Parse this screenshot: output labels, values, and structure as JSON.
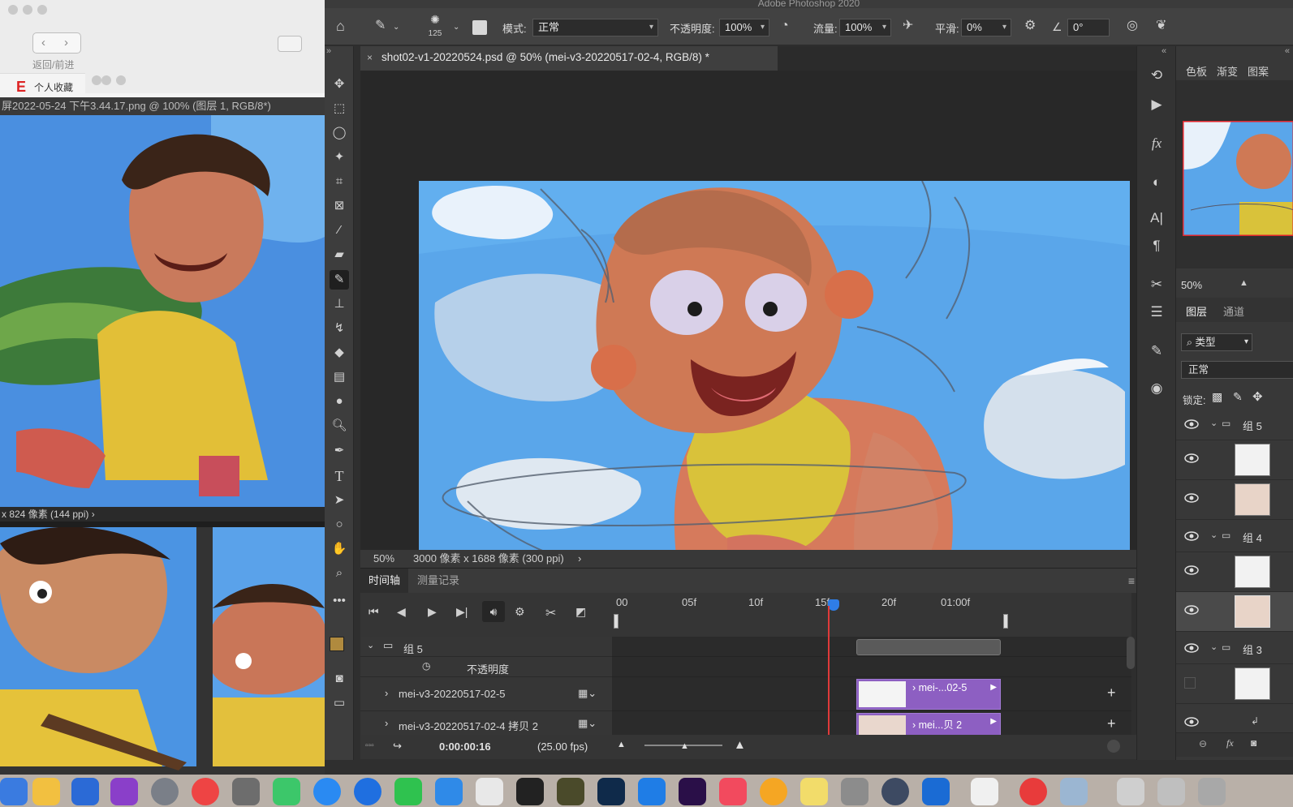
{
  "back_windows": {
    "safari": {
      "nav_label": "返回/前进",
      "favorites_label": "个人收藏"
    },
    "preview_title": "屏2022-05-24 下午3.44.17.png @ 100% (图层 1, RGB/8*)",
    "preview_status": "x 824 像素 (144 ppi)"
  },
  "app": {
    "title": "Adobe Photoshop 2020"
  },
  "options_bar": {
    "brush_size": "125",
    "mode_label": "模式:",
    "mode_value": "正常",
    "opacity_label": "不透明度:",
    "opacity_value": "100%",
    "flow_label": "流量:",
    "flow_value": "100%",
    "smoothing_label": "平滑:",
    "smoothing_value": "0%",
    "angle_value": "0°"
  },
  "document": {
    "tab_title": "shot02-v1-20220524.psd @ 50% (mei-v3-20220517-02-4, RGB/8) *",
    "zoom": "50%",
    "size_info": "3000 像素 x 1688 像素 (300 ppi)"
  },
  "timeline": {
    "tabs": [
      "时间轴",
      "测量记录"
    ],
    "ruler_labels": [
      "00",
      "05f",
      "10f",
      "15f",
      "20f",
      "01:00f"
    ],
    "playhead_frame": 16,
    "group_name": "组 5",
    "opacity_row": "不透明度",
    "layers": [
      {
        "name": "mei-v3-20220517-02-5",
        "clip_label": "mei-...02-5"
      },
      {
        "name": "mei-v3-20220517-02-4 拷贝 2",
        "clip_label": "mei...贝 2"
      }
    ],
    "timecode": "0:00:00:16",
    "fps": "(25.00 fps)"
  },
  "right_panel": {
    "top_tabs": [
      "色板",
      "渐变",
      "图案"
    ],
    "nav_zoom": "50%",
    "layer_tabs": [
      "图层",
      "通道"
    ],
    "filter_kind": "类型",
    "blend_mode": "正常",
    "lock_label": "锁定:",
    "groups": [
      "组 5",
      "组 4",
      "组 3"
    ]
  },
  "colors": {
    "accent": "#8d5fc2",
    "playhead": "#e03a3a",
    "sky": "#5aa6ea",
    "foreground_swatch": "#b08a3e"
  }
}
